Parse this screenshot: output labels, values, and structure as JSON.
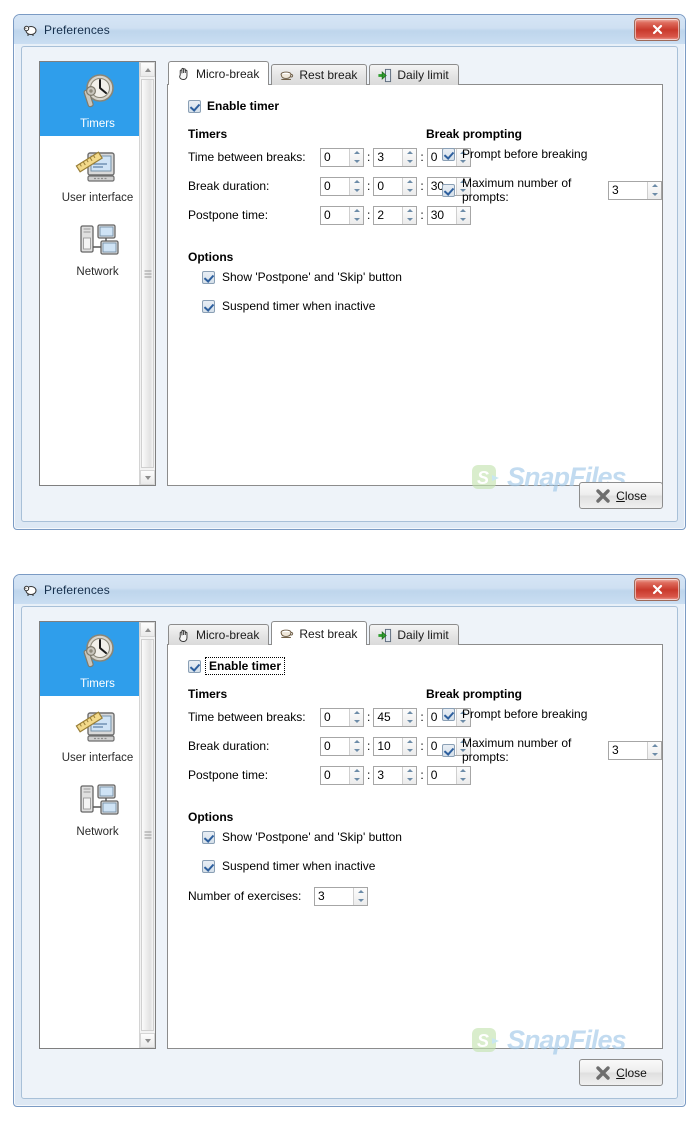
{
  "window": {
    "title": "Preferences",
    "title_icon": "sheep-icon",
    "close_label": "x"
  },
  "sidebar": {
    "items": [
      {
        "label": "Timers",
        "icon": "clock-wrench-icon",
        "selected": true
      },
      {
        "label": "User interface",
        "icon": "monitor-ruler-icon",
        "selected": false
      },
      {
        "label": "Network",
        "icon": "network-computers-icon",
        "selected": false
      }
    ]
  },
  "tabs": [
    {
      "label": "Micro-break",
      "icon": "hand-icon"
    },
    {
      "label": "Rest break",
      "icon": "coffee-cup-icon"
    },
    {
      "label": "Daily limit",
      "icon": "exit-door-icon"
    }
  ],
  "labels": {
    "enable_timer": "Enable timer",
    "timers_heading": "Timers",
    "break_prompting_heading": "Break prompting",
    "options_heading": "Options",
    "time_between_breaks": "Time between breaks:",
    "break_duration": "Break duration:",
    "postpone_time": "Postpone time:",
    "prompt_before_breaking": "Prompt before breaking",
    "maximum_number_of_prompts": "Maximum number of prompts:",
    "show_postpone_skip": "Show 'Postpone' and 'Skip' button",
    "suspend_timer": "Suspend timer when inactive",
    "number_of_exercises": "Number of exercises:",
    "close_button_first": "C",
    "close_button_rest": "lose",
    "colon": ":"
  },
  "watermark": {
    "text": "SnapFiles",
    "logo_letter": "S"
  },
  "windows": [
    {
      "active_tab_index": 0,
      "enable_timer_checked": true,
      "enable_timer_focused": false,
      "timers": [
        {
          "name": "time_between_breaks",
          "h": "0",
          "m": "3",
          "s": "0"
        },
        {
          "name": "break_duration",
          "h": "0",
          "m": "0",
          "s": "30"
        },
        {
          "name": "postpone_time",
          "h": "0",
          "m": "2",
          "s": "30"
        }
      ],
      "prompt_before_breaking_checked": true,
      "maximum_prompts_checked": true,
      "maximum_prompts_value": "3",
      "show_postpone_skip_checked": true,
      "suspend_timer_checked": true,
      "has_exercises": false,
      "exercises_value": ""
    },
    {
      "active_tab_index": 1,
      "enable_timer_checked": true,
      "enable_timer_focused": true,
      "timers": [
        {
          "name": "time_between_breaks",
          "h": "0",
          "m": "45",
          "s": "0"
        },
        {
          "name": "break_duration",
          "h": "0",
          "m": "10",
          "s": "0"
        },
        {
          "name": "postpone_time",
          "h": "0",
          "m": "3",
          "s": "0"
        }
      ],
      "prompt_before_breaking_checked": true,
      "maximum_prompts_checked": true,
      "maximum_prompts_value": "3",
      "show_postpone_skip_checked": true,
      "suspend_timer_checked": true,
      "has_exercises": true,
      "exercises_value": "3"
    }
  ],
  "colors": {
    "selection_blue": "#2f9eeb",
    "titlebar_blue": "#cfe0f2",
    "close_red": "#c9392c",
    "watermark_blue": "#9dc6e8",
    "watermark_green": "#b8dca8"
  }
}
